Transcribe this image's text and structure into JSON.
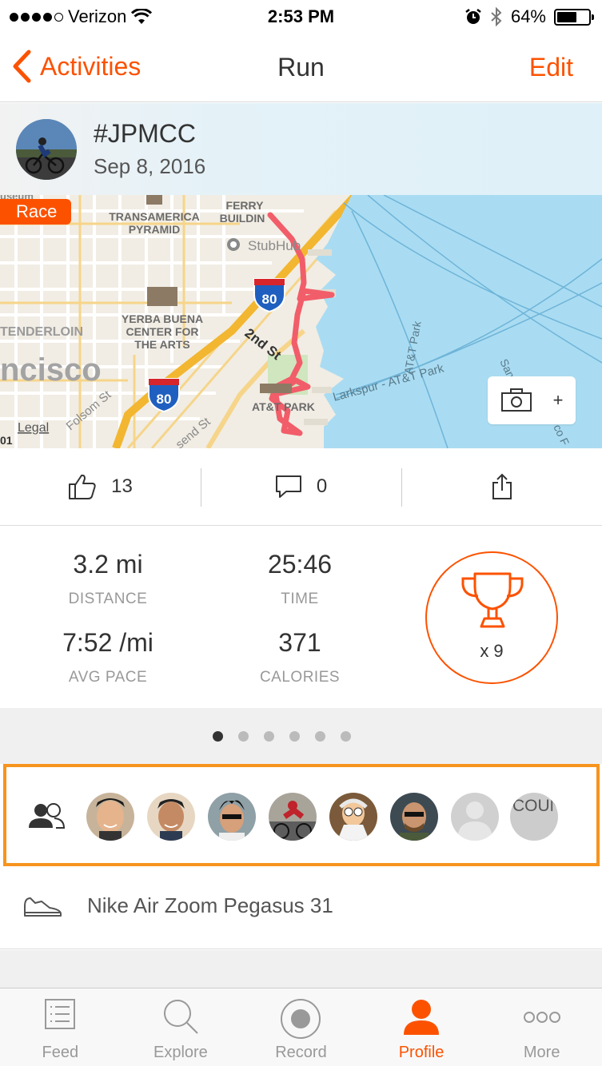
{
  "status_bar": {
    "carrier": "Verizon",
    "time": "2:53 PM",
    "battery": "64%",
    "battery_level": 0.64
  },
  "nav": {
    "back_label": "Activities",
    "title": "Run",
    "edit_label": "Edit"
  },
  "activity": {
    "name": "#JPMCC",
    "date": "Sep 8, 2016",
    "badge": "Race"
  },
  "map": {
    "labels": [
      "TRANSAMERICA",
      "PYRAMID",
      "FERRY",
      "BUILDIN",
      "StubHub",
      "YERBA BUENA",
      "CENTER FOR",
      "THE ARTS",
      "TENDERLOIN",
      "ncisco",
      "2nd St",
      "Folsom St",
      "send St",
      "AT&T PARK",
      "Larkspur - AT&T Park",
      "AT&T Park",
      "Legal",
      "80",
      "80",
      "01",
      "useum",
      "San",
      "co F"
    ]
  },
  "camera": {
    "plus": "+"
  },
  "social": {
    "kudos_count": "13",
    "comment_count": "0"
  },
  "stats": {
    "distance_value": "3.2 mi",
    "distance_label": "DISTANCE",
    "time_value": "25:46",
    "time_label": "TIME",
    "pace_value": "7:52 /mi",
    "pace_label": "AVG PACE",
    "calories_value": "371",
    "calories_label": "CALORIES",
    "achievements": "x 9"
  },
  "pager": {
    "count": 6,
    "active": 0
  },
  "athletes": {
    "more_label": "COUNT..."
  },
  "gear": {
    "shoe": "Nike Air Zoom Pegasus 31"
  },
  "tabs": [
    {
      "label": "Feed"
    },
    {
      "label": "Explore"
    },
    {
      "label": "Record"
    },
    {
      "label": "Profile"
    },
    {
      "label": "More"
    }
  ],
  "colors": {
    "accent": "#fc5200",
    "highlight_border": "#f7941d",
    "route": "#f25d6a",
    "water": "#a9dcf2"
  }
}
